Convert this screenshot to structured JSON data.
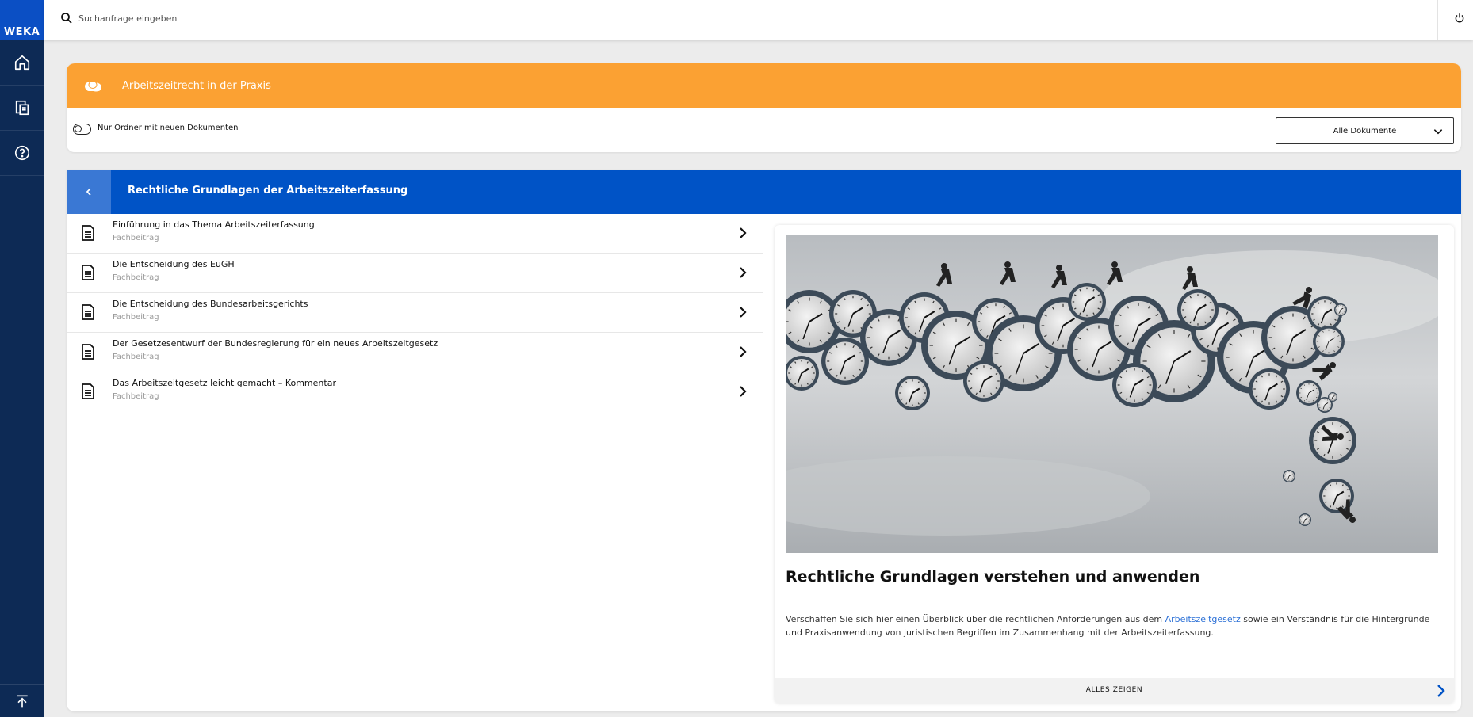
{
  "brand": {
    "logo_text": "WEKA",
    "accent": "#0053c6",
    "orange": "#fba133",
    "sidebar": "#0d2a55"
  },
  "sidebar": {
    "items": [
      {
        "icon": "home-icon"
      },
      {
        "icon": "documents-icon"
      },
      {
        "icon": "help-icon"
      }
    ],
    "bottom_icon": "scroll-to-top-icon"
  },
  "search": {
    "placeholder": "Suchanfrage eingeben",
    "value": ""
  },
  "topbar": {
    "power_icon": "power-icon"
  },
  "folder": {
    "title": "Arbeitszeitrecht in der Praxis",
    "icon": "cloud-icon",
    "toggle_label": "Nur Ordner mit neuen Dokumenten",
    "toggle_on": false,
    "select_value": "Alle Dokumente"
  },
  "section": {
    "title": "Rechtliche Grundlagen der Arbeitszeiterfassung",
    "documents": [
      {
        "title": "Einführung in das Thema Arbeitszeiterfassung",
        "type": "Fachbeitrag"
      },
      {
        "title": "Die Entscheidung des EuGH",
        "type": "Fachbeitrag"
      },
      {
        "title": "Die Entscheidung des Bundesarbeitsgerichts",
        "type": "Fachbeitrag"
      },
      {
        "title": "Der Gesetzesentwurf der Bundesregierung für ein neues Arbeitszeitgesetz",
        "type": "Fachbeitrag"
      },
      {
        "title": "Das Arbeitszeitgesetz leicht gemacht – Kommentar",
        "type": "Fachbeitrag"
      }
    ]
  },
  "teaser": {
    "heading": "Rechtliche Grundlagen verstehen und anwenden",
    "text_before": "Verschaffen Sie sich hier einen Überblick über die rechtlichen Anforderungen aus dem ",
    "link_text": "Arbeitszeitgesetz",
    "text_after": " sowie ein Verständnis für die Hintergründe und Praxisanwendung von juristischen Begriffen im Zusammenhang mit der Arbeitszeiterfassung.",
    "show_all_label": "ALLES ZEIGEN"
  }
}
